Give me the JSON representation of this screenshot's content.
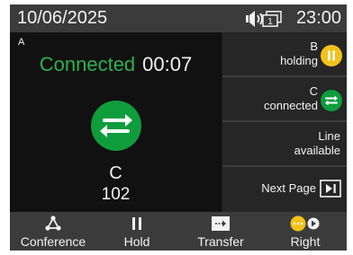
{
  "statusbar": {
    "date": "10/06/2025",
    "time": "23:00",
    "icons": [
      "speaker-icon",
      "line-indicator-icon"
    ],
    "line_indicator_number": "1"
  },
  "call": {
    "line_label": "A",
    "status": "Connected",
    "timer": "00:07",
    "icon": "transfer-arrows-icon",
    "contact_name": "C",
    "contact_number": "102"
  },
  "line_keys": [
    {
      "label": "B",
      "status": "holding",
      "icon": "pause-icon",
      "color": "#f2c21b"
    },
    {
      "label": "C",
      "status": "connected",
      "icon": "transfer-arrows-icon",
      "color": "#0f9d3c"
    },
    {
      "label": "Line",
      "status": "available"
    },
    {
      "label": "Next Page",
      "icon": "next-page-icon"
    }
  ],
  "softkeys": [
    {
      "label": "Conference",
      "icon": "conference-icon"
    },
    {
      "label": "Hold",
      "icon": "pause-icon"
    },
    {
      "label": "Transfer",
      "icon": "transfer-icon"
    },
    {
      "label": "Right",
      "icon": "more-right-icon"
    }
  ],
  "colors": {
    "accent_green": "#0f9d3c",
    "status_text_green": "#2eb14f",
    "hold_yellow": "#f2c21b"
  }
}
